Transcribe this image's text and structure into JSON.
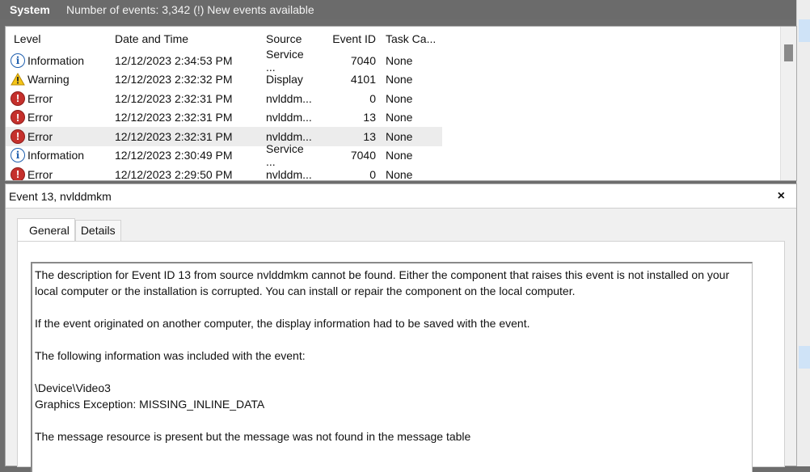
{
  "header": {
    "title": "System",
    "info": "Number of events: 3,342 (!) New events available"
  },
  "columns": {
    "level": "Level",
    "date": "Date and Time",
    "source": "Source",
    "event_id": "Event ID",
    "task": "Task Ca..."
  },
  "events": [
    {
      "level": "Information",
      "icon": "info-icon",
      "date": "12/12/2023 2:34:53 PM",
      "source": "Service ...",
      "event_id": "7040",
      "task": "None"
    },
    {
      "level": "Warning",
      "icon": "warning-icon",
      "date": "12/12/2023 2:32:32 PM",
      "source": "Display",
      "event_id": "4101",
      "task": "None"
    },
    {
      "level": "Error",
      "icon": "error-icon",
      "date": "12/12/2023 2:32:31 PM",
      "source": "nvlddm...",
      "event_id": "0",
      "task": "None"
    },
    {
      "level": "Error",
      "icon": "error-icon",
      "date": "12/12/2023 2:32:31 PM",
      "source": "nvlddm...",
      "event_id": "13",
      "task": "None"
    },
    {
      "level": "Error",
      "icon": "error-icon",
      "date": "12/12/2023 2:32:31 PM",
      "source": "nvlddm...",
      "event_id": "13",
      "task": "None"
    },
    {
      "level": "Information",
      "icon": "info-icon",
      "date": "12/12/2023 2:30:49 PM",
      "source": "Service ...",
      "event_id": "7040",
      "task": "None"
    },
    {
      "level": "Error",
      "icon": "error-icon",
      "date": "12/12/2023 2:29:50 PM",
      "source": "nvlddm...",
      "event_id": "0",
      "task": "None"
    }
  ],
  "detail": {
    "title": "Event 13, nvlddmkm",
    "close": "×",
    "tabs": [
      "General",
      "Details"
    ],
    "message": {
      "p1": "The description for Event ID 13 from source nvlddmkm cannot be found. Either the component that raises this event is not installed on your local computer or the installation is corrupted. You can install or repair the component on the local computer.",
      "p2": "If the event originated on another computer, the display information had to be saved with the event.",
      "p3": "The following information was included with the event:",
      "p4a": "\\Device\\Video3",
      "p4b": "Graphics Exception:  MISSING_INLINE_DATA",
      "p5": "The message resource is present but the message was not found in the message table"
    }
  }
}
